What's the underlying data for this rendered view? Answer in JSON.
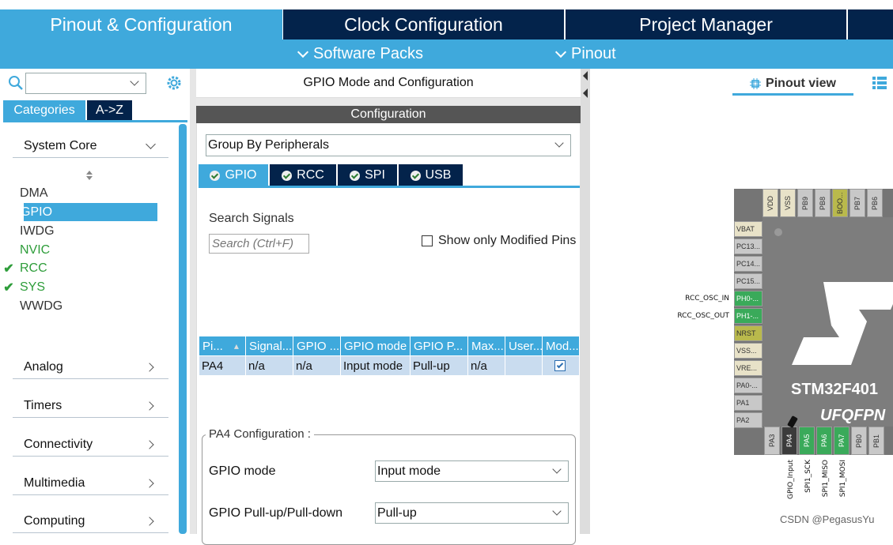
{
  "top_tabs": [
    {
      "label": "Pinout & Configuration",
      "active": true
    },
    {
      "label": "Clock Configuration",
      "active": false
    },
    {
      "label": "Project Manager",
      "active": false
    }
  ],
  "sub_menu": [
    "Software Packs",
    "Pinout"
  ],
  "left": {
    "search_value": "",
    "tab_categories": "Categories",
    "tab_az": "A->Z",
    "system_core": "System Core",
    "system_core_items": [
      {
        "label": "DMA",
        "checked": false,
        "color": "#333333"
      },
      {
        "label": "GPIO",
        "checked": false,
        "color": "#ffffff",
        "selected": true
      },
      {
        "label": "IWDG",
        "checked": false,
        "color": "#333333"
      },
      {
        "label": "NVIC",
        "checked": false,
        "color": "#2e9d3a"
      },
      {
        "label": "RCC",
        "checked": true,
        "color": "#2e9d3a"
      },
      {
        "label": "SYS",
        "checked": true,
        "color": "#2e9d3a"
      },
      {
        "label": "WWDG",
        "checked": false,
        "color": "#333333"
      }
    ],
    "categories": [
      "Analog",
      "Timers",
      "Connectivity",
      "Multimedia",
      "Computing"
    ]
  },
  "mid": {
    "header": "GPIO Mode and Configuration",
    "config_title": "Configuration",
    "group_select": "Group By Peripherals",
    "tabs": [
      "GPIO",
      "RCC",
      "SPI",
      "USB"
    ],
    "search_label": "Search Signals",
    "search_placeholder": "Search (Ctrl+F)",
    "show_modified": "Show only Modified Pins",
    "table_headers": [
      "Pi...",
      "Signal...",
      "GPIO ...",
      "GPIO mode",
      "GPIO P...",
      "Max...",
      "User...",
      "Mod..."
    ],
    "table_row": [
      "PA4",
      "n/a",
      "n/a",
      "Input mode",
      "Pull-up",
      "n/a",
      "",
      ""
    ],
    "pa4_legend": "PA4 Configuration :",
    "gpio_mode_label": "GPIO mode",
    "gpio_mode_value": "Input mode",
    "gpio_pull_label": "GPIO Pull-up/Pull-down",
    "gpio_pull_value": "Pull-up"
  },
  "right": {
    "pinout_view": "Pinout view",
    "chip_name": "STM32F401",
    "chip_package": "UFQFPN",
    "top_pins": [
      "VDD",
      "VSS",
      "PB9",
      "PB8",
      "BOO...",
      "PB7",
      "PB6"
    ],
    "left_pins": [
      "VBAT",
      "PC13...",
      "PC14...",
      "PC15...",
      "PH0-...",
      "PH1-...",
      "NRST",
      "VSS...",
      "VRE...",
      "PA0-...",
      "PA1",
      "PA2"
    ],
    "bottom_pins": [
      "PA3",
      "PA4",
      "PA5",
      "PA6",
      "PA7",
      "PB0",
      "PB1"
    ],
    "left_signals": [
      "RCC_OSC_IN",
      "RCC_OSC_OUT"
    ],
    "bottom_signals": [
      "GPIO_Input",
      "SPI1_SCK",
      "SPI1_MISO",
      "SPI1_MOSI"
    ],
    "watermark": "CSDN @PegasusYu"
  },
  "colors": {
    "accent": "#3fa9dc",
    "navy": "#03234b",
    "pin_green": "#3aaa5a",
    "pin_yellow": "#b9b94c"
  }
}
